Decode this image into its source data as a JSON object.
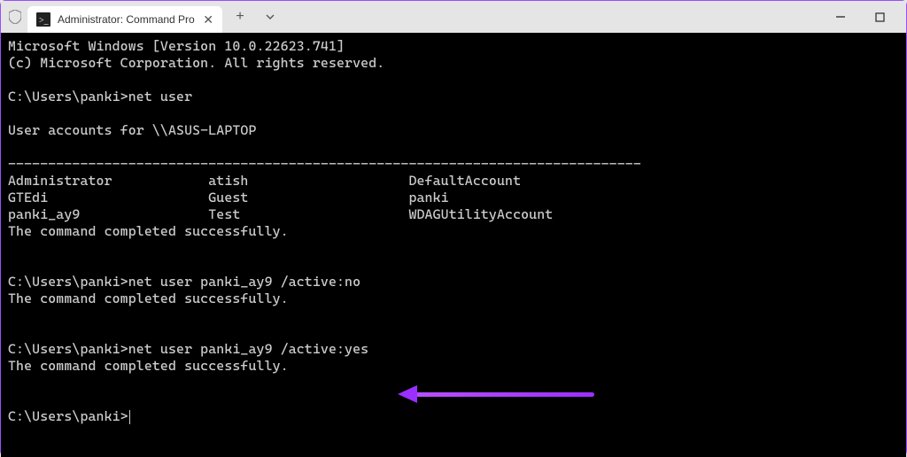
{
  "tab": {
    "title": "Administrator: Command Pro",
    "icon_name": "cmd-icon"
  },
  "terminal": {
    "line1": "Microsoft Windows [Version 10.0.22623.741]",
    "line2": "(c) Microsoft Corporation. All rights reserved.",
    "prompt1": "C:\\Users\\panki>",
    "cmd1": "net user",
    "acctheader": "User accounts for \\\\ASUS-LAPTOP",
    "divider": "-------------------------------------------------------------------------------",
    "row1": "Administrator            atish                    DefaultAccount",
    "row2": "GTEdi                    Guest                    panki",
    "row3": "panki_ay9                Test                     WDAGUtilityAccount",
    "success": "The command completed successfully.",
    "prompt2": "C:\\Users\\panki>",
    "cmd2": "net user panki_ay9 /active:no",
    "prompt3": "C:\\Users\\panki>",
    "cmd3": "net user panki_ay9 /active:yes",
    "prompt4": "C:\\Users\\panki>"
  }
}
